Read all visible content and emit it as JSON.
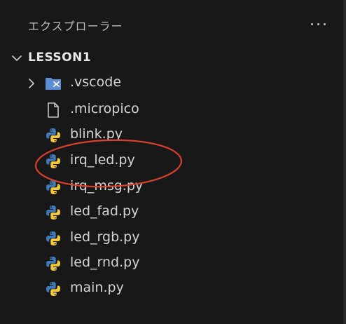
{
  "explorer": {
    "title": "エクスプローラー",
    "more_icon": "ellipsis-icon"
  },
  "workspace": {
    "folder_name": "LESSON1",
    "items": [
      {
        "label": ".vscode",
        "icon": "vscode-folder-icon",
        "type": "folder",
        "expanded": false
      },
      {
        "label": ".micropico",
        "icon": "file-icon",
        "type": "file"
      },
      {
        "label": "blink.py",
        "icon": "python-icon",
        "type": "file"
      },
      {
        "label": "irq_led.py",
        "icon": "python-icon",
        "type": "file",
        "highlighted": true
      },
      {
        "label": "irq_msg.py",
        "icon": "python-icon",
        "type": "file"
      },
      {
        "label": "led_fad.py",
        "icon": "python-icon",
        "type": "file"
      },
      {
        "label": "led_rgb.py",
        "icon": "python-icon",
        "type": "file"
      },
      {
        "label": "led_rnd.py",
        "icon": "python-icon",
        "type": "file"
      },
      {
        "label": "main.py",
        "icon": "python-icon",
        "type": "file"
      }
    ]
  },
  "colors": {
    "background": "#181818",
    "annotation": "#d9412e",
    "python_blue": "#3d7ab8",
    "python_yellow": "#f2c83b",
    "folder_blue": "#5d8fd6"
  }
}
